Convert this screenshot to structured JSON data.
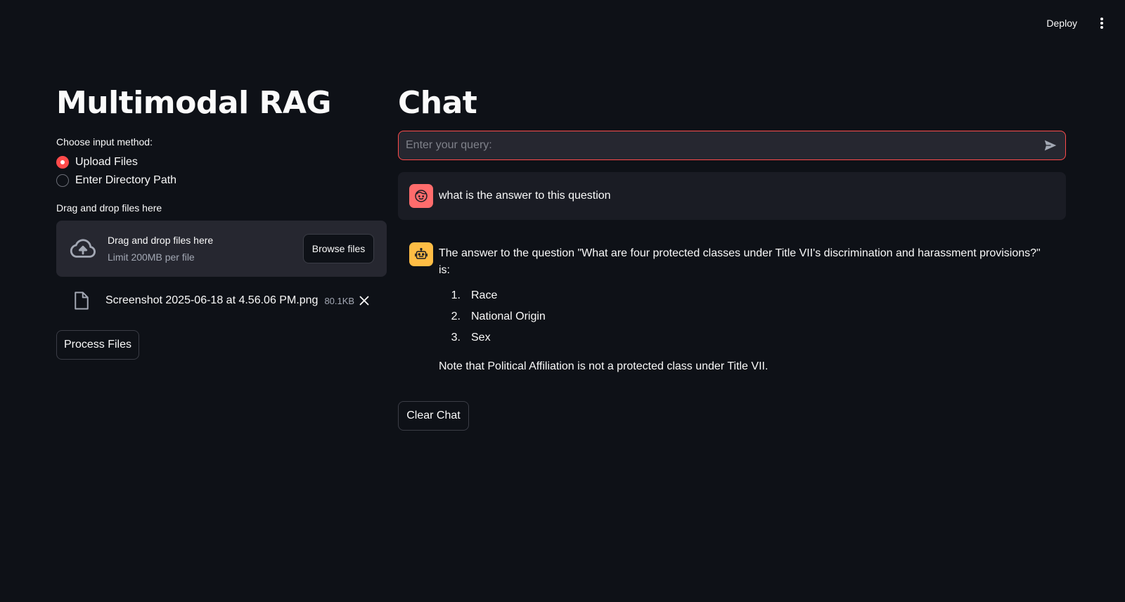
{
  "header": {
    "deploy_label": "Deploy",
    "menu_icon": "kebab-menu-icon"
  },
  "sidebar": {
    "title": "Multimodal RAG",
    "input_method_label": "Choose input method:",
    "options": [
      {
        "label": "Upload Files",
        "selected": true
      },
      {
        "label": "Enter Directory Path",
        "selected": false
      }
    ],
    "uploader": {
      "label": "Drag and drop files here",
      "dropzone_title": "Drag and drop files here",
      "dropzone_limit": "Limit 200MB per file",
      "browse_label": "Browse files",
      "upload_icon": "cloud-upload-icon"
    },
    "files": [
      {
        "name": "Screenshot 2025-06-18 at 4.56.06 PM.png",
        "size": "80.1KB",
        "icon": "file-icon"
      }
    ],
    "process_label": "Process Files"
  },
  "chat": {
    "title": "Chat",
    "query_placeholder": "Enter your query:",
    "query_value": "",
    "user_message": "what is the answer to this question",
    "assistant": {
      "intro": "The answer to the question \"What are four protected classes under Title VII's discrimination and harassment provisions?\" is:",
      "items": [
        {
          "num": "1.",
          "text": "Race"
        },
        {
          "num": "2.",
          "text": "National Origin"
        },
        {
          "num": "3.",
          "text": "Sex"
        }
      ],
      "note": "Note that Political Affiliation is not a protected class under Title VII."
    },
    "clear_label": "Clear Chat"
  },
  "colors": {
    "background": "#0e1117",
    "accent": "#ff4b4b",
    "user_avatar": "#ff6c6c",
    "bot_avatar": "#ffbd45",
    "surface": "#262730"
  }
}
